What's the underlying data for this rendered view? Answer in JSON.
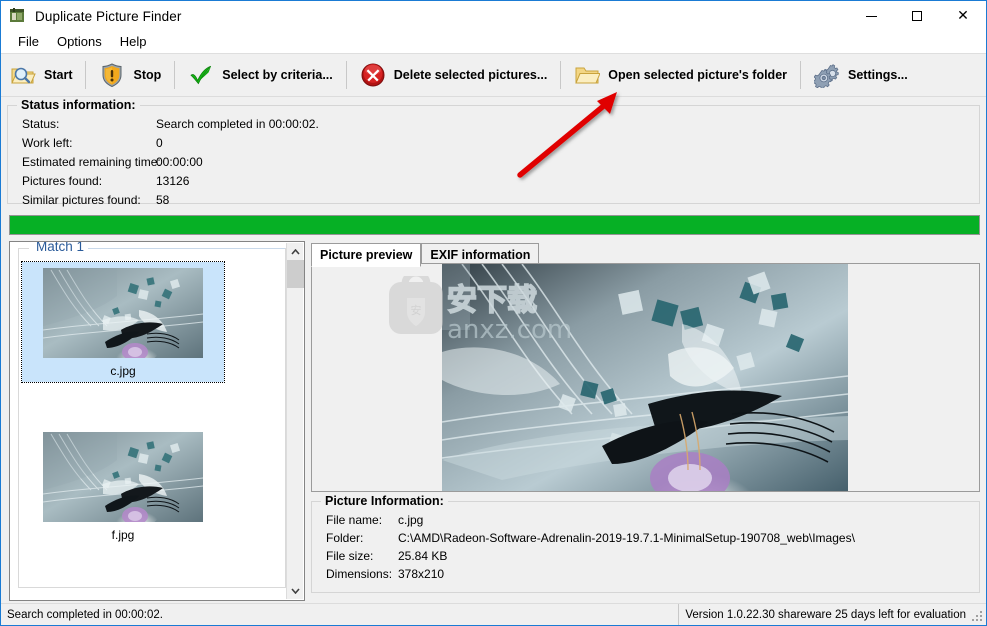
{
  "window": {
    "title": "Duplicate Picture Finder",
    "icon": "app-icon",
    "controls": {
      "minimize": "—",
      "maximize": "□",
      "close": "✕"
    }
  },
  "menubar": {
    "items": [
      {
        "label": "File"
      },
      {
        "label": "Options"
      },
      {
        "label": "Help"
      }
    ]
  },
  "toolbar": {
    "buttons": [
      {
        "label": "Start",
        "icon": "folder-search-icon"
      },
      {
        "label": "Stop",
        "icon": "warning-shield-icon"
      },
      {
        "label": "Select by criteria...",
        "icon": "green-check-icon"
      },
      {
        "label": "Delete selected pictures...",
        "icon": "red-delete-icon"
      },
      {
        "label": "Open selected picture's folder",
        "icon": "folder-open-icon"
      },
      {
        "label": "Settings...",
        "icon": "gears-icon"
      }
    ]
  },
  "status_information": {
    "title": "Status information:",
    "rows": [
      {
        "key": "Status:",
        "value": "Search completed in 00:00:02."
      },
      {
        "key": "Work left:",
        "value": "0"
      },
      {
        "key": "Estimated remaining time:",
        "value": "00:00:00"
      },
      {
        "key": "Pictures found:",
        "value": "13126"
      },
      {
        "key": "Similar pictures found:",
        "value": "58"
      }
    ]
  },
  "progress": {
    "percent": 100,
    "color": "#06b025"
  },
  "matches": {
    "group_label": "Match 1",
    "items": [
      {
        "name": "c.jpg",
        "selected": true
      },
      {
        "name": "f.jpg",
        "selected": false
      }
    ],
    "scrollbar": {
      "up": "⌃",
      "down": "⌄"
    }
  },
  "preview": {
    "tabs": [
      {
        "label": "Picture preview",
        "active": true
      },
      {
        "label": "EXIF information",
        "active": false
      }
    ],
    "watermark_text": "anxz.com"
  },
  "picture_information": {
    "title": "Picture Information:",
    "rows": [
      {
        "key": "File name:",
        "value": "c.jpg"
      },
      {
        "key": "Folder:",
        "value": "C:\\AMD\\Radeon-Software-Adrenalin-2019-19.7.1-MinimalSetup-190708_web\\Images\\"
      },
      {
        "key": "File size:",
        "value": "25.84 KB"
      },
      {
        "key": "Dimensions:",
        "value": "378x210"
      }
    ]
  },
  "statusbar": {
    "left": "Search completed in 00:00:02.",
    "right": "Version 1.0.22.30 shareware 25 days left for evaluation"
  },
  "annotation": {
    "arrow_color": "#e00000"
  }
}
